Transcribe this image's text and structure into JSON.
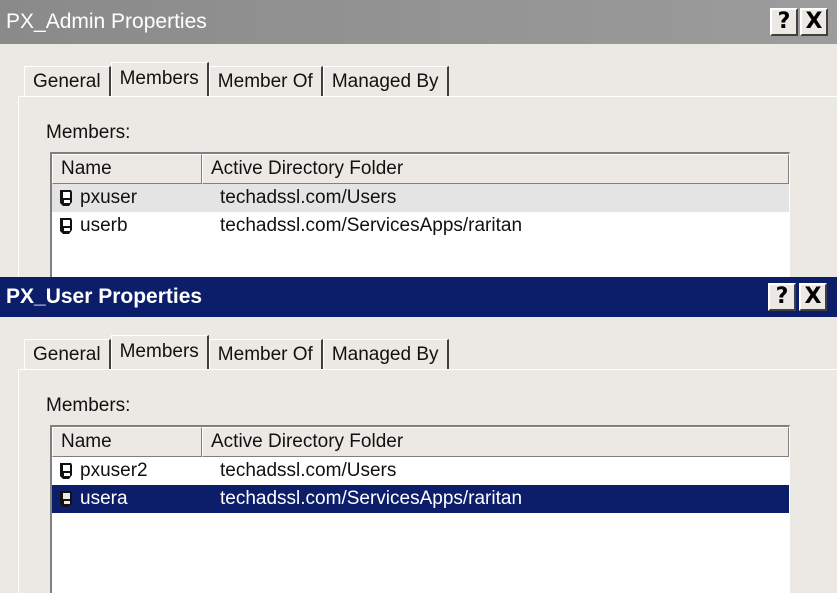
{
  "dialogs": [
    {
      "title": "PX_Admin Properties",
      "help_button": "?",
      "close_button": "X",
      "tabs": [
        "General",
        "Members",
        "Member Of",
        "Managed By"
      ],
      "active_tab": "Members",
      "members_label": "Members:",
      "columns": [
        "Name",
        "Active Directory Folder"
      ],
      "rows": [
        {
          "name": "pxuser",
          "folder": "techadssl.com/Users"
        },
        {
          "name": "userb",
          "folder": "techadssl.com/ServicesApps/raritan"
        }
      ]
    },
    {
      "title": "PX_User Properties",
      "help_button": "?",
      "close_button": "X",
      "tabs": [
        "General",
        "Members",
        "Member Of",
        "Managed By"
      ],
      "active_tab": "Members",
      "members_label": "Members:",
      "columns": [
        "Name",
        "Active Directory Folder"
      ],
      "rows": [
        {
          "name": "pxuser2",
          "folder": "techadssl.com/Users"
        },
        {
          "name": "usera",
          "folder": "techadssl.com/ServicesApps/raritan",
          "selected": true
        }
      ]
    }
  ],
  "icons": {
    "user": "user-icon"
  },
  "colors": {
    "active_title": "#0c1d6a",
    "inactive_title": "#8a8a8a",
    "selection": "#0c1d6a"
  }
}
